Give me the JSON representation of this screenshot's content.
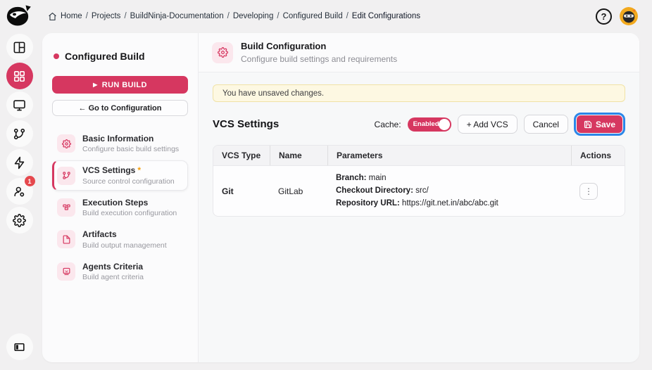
{
  "colors": {
    "accent": "#d63760",
    "accent_soft": "#fbe7ed",
    "focus_ring": "#2b86e8",
    "banner_bg": "#fdf8e2",
    "banner_border": "#f0e2a6",
    "notification_badge": "#e5484d",
    "required_asterisk": "#f59e0b"
  },
  "icons": {
    "play": "▶",
    "help": "?",
    "more": "⋮"
  },
  "topbar": {
    "breadcrumb": {
      "separator": "/",
      "items": [
        "Home",
        "Projects",
        "BuildNinja-Documentation",
        "Developing",
        "Configured Build",
        "Edit Configurations"
      ]
    }
  },
  "rail": {
    "badge_count": "1"
  },
  "sidebar": {
    "title": "Configured Build",
    "run_build_label": "RUN BUILD",
    "goto_config_label": "← Go to Configuration",
    "items": [
      {
        "label": "Basic Information",
        "sub": "Configure basic build settings"
      },
      {
        "label": "VCS Settings",
        "required": "*",
        "sub": "Source control configuration"
      },
      {
        "label": "Execution Steps",
        "sub": "Build execution configuration"
      },
      {
        "label": "Artifacts",
        "sub": "Build output management"
      },
      {
        "label": "Agents Criteria",
        "sub": "Build agent criteria"
      }
    ]
  },
  "main": {
    "header": {
      "title": "Build Configuration",
      "subtitle": "Configure build settings and requirements"
    },
    "banner": "You have unsaved changes.",
    "section": {
      "title": "VCS Settings",
      "cache_label": "Cache:",
      "cache_state": "Enabled",
      "add_vcs_label": "+ Add VCS",
      "cancel_label": "Cancel",
      "save_label": "Save"
    },
    "table": {
      "columns": [
        "VCS Type",
        "Name",
        "Parameters",
        "Actions"
      ],
      "rows": [
        {
          "vcs_type": "Git",
          "name": "GitLab",
          "params": [
            {
              "label": "Branch:",
              "value": " main"
            },
            {
              "label": "Checkout Directory:",
              "value": " src/"
            },
            {
              "label": "Repository URL:",
              "value": " https://git.net.in/abc/abc.git"
            }
          ]
        }
      ]
    }
  }
}
